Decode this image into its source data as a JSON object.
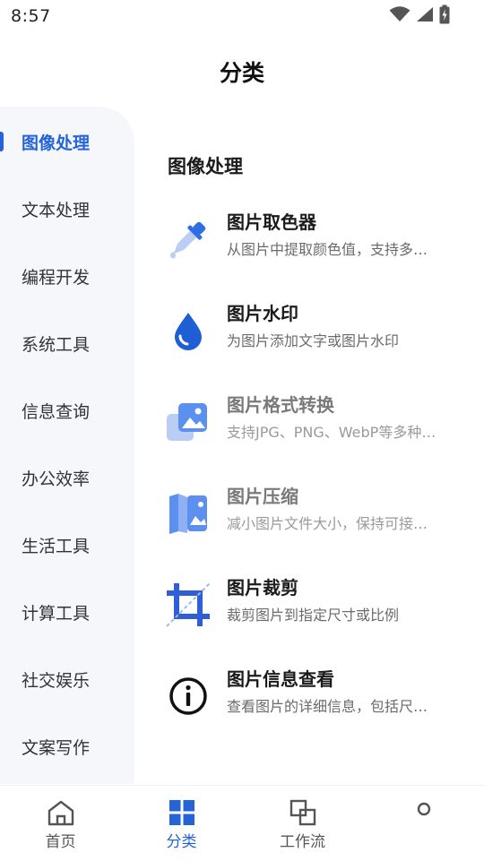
{
  "status_bar": {
    "time": "8:57",
    "icons": [
      "wifi-icon",
      "cellular-signal-icon",
      "battery-charging-icon"
    ]
  },
  "header": {
    "title": "分类"
  },
  "sidebar": {
    "items": [
      {
        "label": "图像处理",
        "active": true
      },
      {
        "label": "文本处理",
        "active": false
      },
      {
        "label": "编程开发",
        "active": false
      },
      {
        "label": "系统工具",
        "active": false
      },
      {
        "label": "信息查询",
        "active": false
      },
      {
        "label": "办公效率",
        "active": false
      },
      {
        "label": "生活工具",
        "active": false
      },
      {
        "label": "计算工具",
        "active": false
      },
      {
        "label": "社交娱乐",
        "active": false
      },
      {
        "label": "文案写作",
        "active": false
      }
    ]
  },
  "content": {
    "section_title": "图像处理",
    "tools": [
      {
        "name": "图片取色器",
        "desc": "从图片中提取颜色值，支持多…",
        "icon": "eyedropper-icon"
      },
      {
        "name": "图片水印",
        "desc": "为图片添加文字或图片水印",
        "icon": "water-drop-icon"
      },
      {
        "name": "图片格式转换",
        "desc": "支持JPG、PNG、WebP等多种…",
        "icon": "image-convert-icon"
      },
      {
        "name": "图片压缩",
        "desc": "减小图片文件大小，保持可接…",
        "icon": "image-compress-icon"
      },
      {
        "name": "图片裁剪",
        "desc": "裁剪图片到指定尺寸或比例",
        "icon": "crop-icon"
      },
      {
        "name": "图片信息查看",
        "desc": "查看图片的详细信息，包括尺…",
        "icon": "info-icon"
      }
    ]
  },
  "bottom_nav": {
    "items": [
      {
        "label": "首页",
        "icon": "home-icon",
        "active": false
      },
      {
        "label": "分类",
        "icon": "grid-icon",
        "active": true
      },
      {
        "label": "工作流",
        "icon": "workflow-icon",
        "active": false
      },
      {
        "label": "",
        "icon": "profile-icon",
        "active": false
      }
    ]
  },
  "colors": {
    "accent": "#2563d8",
    "sidebar_bg": "#f5f7fb"
  }
}
